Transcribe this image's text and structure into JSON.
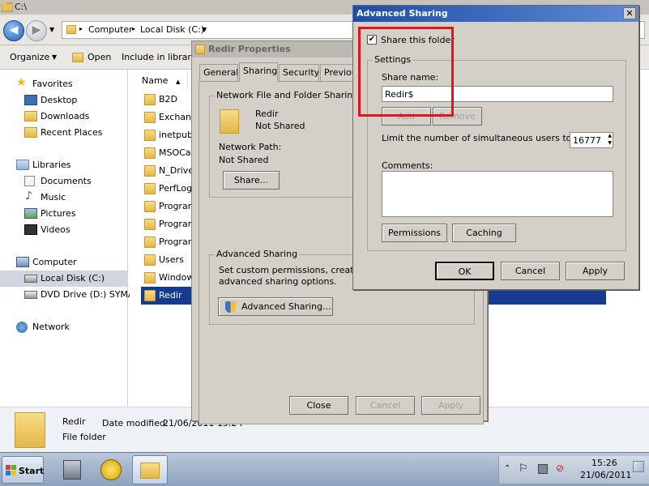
{
  "explorer": {
    "title": "C:\\",
    "address": {
      "crumbs": [
        "Computer",
        "Local Disk (C:)"
      ]
    },
    "commands": {
      "organize": "Organize",
      "open": "Open",
      "include": "Include in library"
    },
    "nav": {
      "favorites": "Favorites",
      "desktop": "Desktop",
      "downloads": "Downloads",
      "recent": "Recent Places",
      "libraries": "Libraries",
      "documents": "Documents",
      "music": "Music",
      "pictures": "Pictures",
      "videos": "Videos",
      "computer": "Computer",
      "local_disk": "Local Disk (C:)",
      "dvd": "DVD Drive (D:) SYMAN",
      "network": "Network"
    },
    "column_name": "Name",
    "files": [
      "B2D",
      "Exchang",
      "inetpub",
      "MSOCac",
      "N_Drive",
      "PerfLogs",
      "Program",
      "Program",
      "Program",
      "Users",
      "Window",
      "Redir"
    ],
    "details": {
      "name": "Redir",
      "date_label": "Date modified:",
      "date_value": "21/06/2011 15:24",
      "type": "File folder"
    }
  },
  "props": {
    "title": "Redir Properties",
    "tabs": [
      "General",
      "Sharing",
      "Security",
      "Previou"
    ],
    "network_group": "Network File and Folder Sharing",
    "folder_name": "Redir",
    "folder_status": "Not Shared",
    "network_path_label": "Network Path:",
    "network_path_value": "Not Shared",
    "share_button": "Share...",
    "advanced_group": "Advanced Sharing",
    "advanced_desc_1": "Set custom permissions, create mult",
    "advanced_desc_2": "advanced sharing options.",
    "advanced_button": "Advanced Sharing...",
    "close": "Close",
    "cancel": "Cancel",
    "apply": "Apply"
  },
  "adv": {
    "title": "Advanced Sharing",
    "close_glyph": "✕",
    "share_checkbox": "Share this folder",
    "share_checked": true,
    "check_glyph": "✔",
    "settings_group": "Settings",
    "share_name_label": "Share name:",
    "share_name_value": "Redir$",
    "add": "Add",
    "remove": "Remove",
    "limit_label": "Limit the number of simultaneous users to:",
    "limit_value": "16777",
    "comments_label": "Comments:",
    "comments_value": "",
    "permissions": "Permissions",
    "caching": "Caching",
    "ok": "OK",
    "cancel": "Cancel",
    "apply": "Apply"
  },
  "taskbar": {
    "start": "Start",
    "time": "15:26",
    "date": "21/06/2011"
  }
}
